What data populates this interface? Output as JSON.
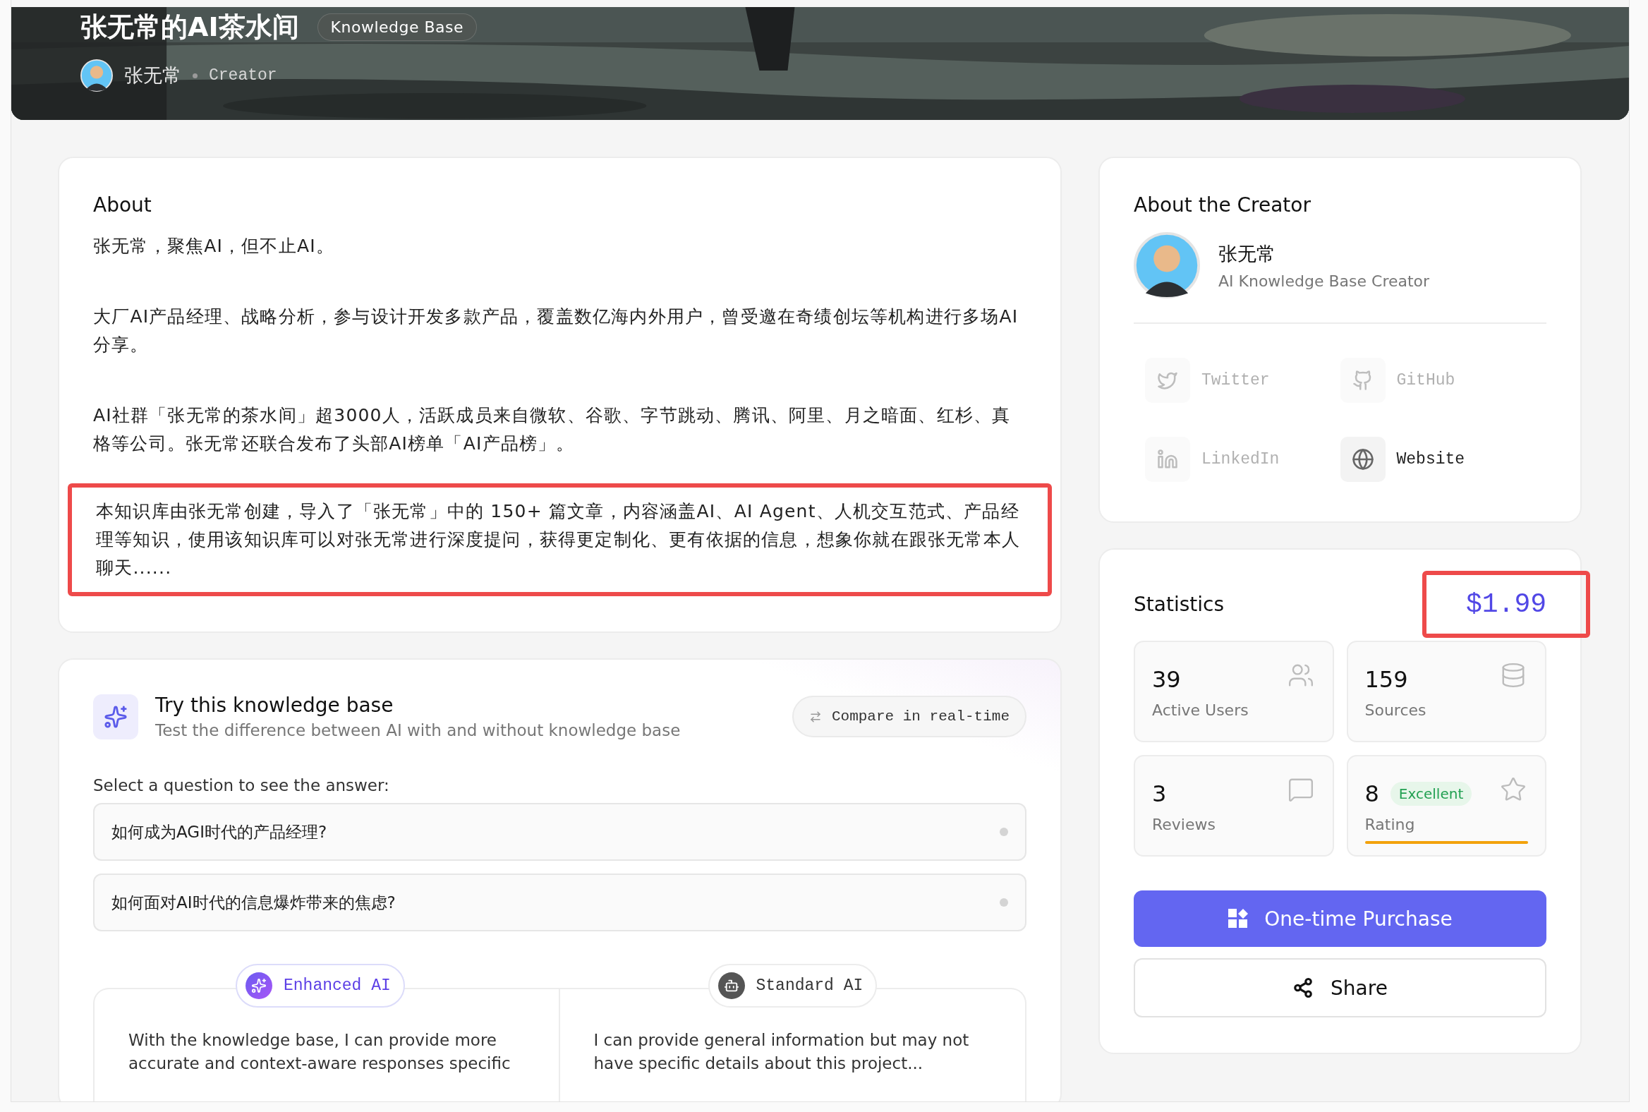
{
  "hero": {
    "title": "张无常的AI茶水间",
    "badge": "Knowledge Base",
    "creator": "张无常",
    "role": "Creator"
  },
  "about": {
    "title": "About",
    "paragraphs": [
      {
        "text": "张无常，聚焦AI，但不止AI。",
        "highlighted": false
      },
      {
        "text": "大厂AI产品经理、战略分析，参与设计开发多款产品，覆盖数亿海内外用户，曾受邀在奇绩创坛等机构进行多场AI分享。",
        "highlighted": false
      },
      {
        "text": "AI社群「张无常的茶水间」超3000人，活跃成员来自微软、谷歌、字节跳动、腾讯、阿里、月之暗面、红杉、真格等公司。张无常还联合发布了头部AI榜单「AI产品榜」。",
        "highlighted": false
      },
      {
        "text": "本知识库由张无常创建，导入了「张无常」中的 150+ 篇文章，内容涵盖AI、AI Agent、人机交互范式、产品经理等知识，使用该知识库可以对张无常进行深度提问，获得更定制化、更有依据的信息，想象你就在跟张无常本人聊天......",
        "highlighted": true
      }
    ]
  },
  "try_panel": {
    "title": "Try this knowledge base",
    "subtitle": "Test the difference between AI with and without knowledge base",
    "compare_button": "Compare in real-time",
    "prompt": "Select a question to see the answer:",
    "questions": [
      {
        "text": "如何成为AGI时代的产品经理?",
        "selected": false
      },
      {
        "text": "如何面对AI时代的信息爆炸带来的焦虑?",
        "selected": false
      }
    ],
    "answers": [
      {
        "kind": "enhanced",
        "label": "Enhanced AI",
        "text": "With the knowledge base, I can provide more accurate and context-aware responses specific"
      },
      {
        "kind": "standard",
        "label": "Standard AI",
        "text": "I can provide general information but may not have specific details about this project..."
      }
    ]
  },
  "creator_card": {
    "title": "About the Creator",
    "name": "张无常",
    "subtitle": "AI Knowledge Base Creator",
    "links": [
      {
        "kind": "twitter",
        "label": "Twitter",
        "disabled": true
      },
      {
        "kind": "github",
        "label": "GitHub",
        "disabled": true
      },
      {
        "kind": "linkedin",
        "label": "LinkedIn",
        "disabled": true
      },
      {
        "kind": "website",
        "label": "Website",
        "disabled": false
      }
    ]
  },
  "statistics": {
    "title": "Statistics",
    "price": "$1.99",
    "price_highlighted": true,
    "items": [
      {
        "kind": "users",
        "value": "39",
        "label": "Active Users"
      },
      {
        "kind": "sources",
        "value": "159",
        "label": "Sources"
      },
      {
        "kind": "reviews",
        "value": "3",
        "label": "Reviews"
      },
      {
        "kind": "rating",
        "value": "8",
        "badge": "Excellent",
        "label": "Rating",
        "level": 1
      }
    ],
    "purchase_button": "One-time Purchase",
    "share_button": "Share"
  }
}
